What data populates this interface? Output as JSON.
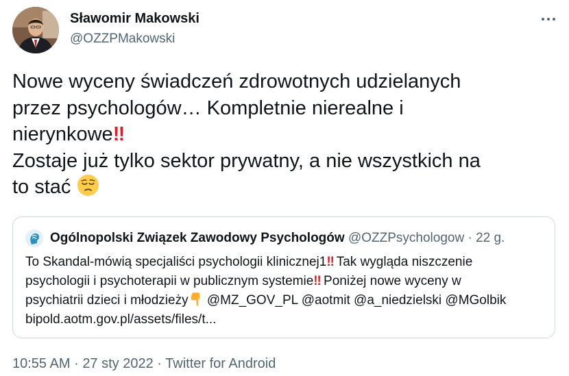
{
  "author": {
    "name": "Sławomir Makowski",
    "handle": "@OZZPMakowski"
  },
  "tweet": {
    "line1": "Nowe wyceny świadczeń zdrowotnych udzielanych",
    "line2": "przez psychologów… Kompletnie nierealne i",
    "line3": "nierynkowe",
    "line3_emoji": "‼",
    "line4": "Zostaje już tylko sektor prywatny, a nie wszystkich na",
    "line5": "to stać",
    "line5_emoji": "pensive-face-emoji"
  },
  "quoted": {
    "name": "Ogólnopolski Związek Zawodowy Psychologów",
    "handle": "@OZZPsychologow",
    "separator": "·",
    "time": "22 g.",
    "line1_a": "To Skandal-mówią specjaliści psychologii klinicznej1",
    "line1_emoji": "‼",
    "line1_b": " Tak wygląda niszczenie",
    "line2_a": "psychologii i psychoterapii w publicznym systemie",
    "line2_emoji": "‼",
    "line2_b": " Poniżej nowe wyceny w",
    "line3_a": "psychiatrii dzieci i młodzieży",
    "line3_emoji": "pointing-down-hand-emoji",
    "line3_b": " @MZ_GOV_PL @aotmit @a_niedzielski @MGolbik",
    "line4": "bipold.aotm.gov.pl/assets/files/t..."
  },
  "footer": {
    "time": "10:55 AM",
    "sep1": "·",
    "date": "27 sty 2022",
    "sep2": "·",
    "source": "Twitter for Android"
  },
  "icons": {
    "more": "more-horizontal-icon"
  },
  "colors": {
    "text": "#0f1419",
    "secondary": "#536471",
    "border": "#cfd9de",
    "exclamation": "#d0242d"
  }
}
